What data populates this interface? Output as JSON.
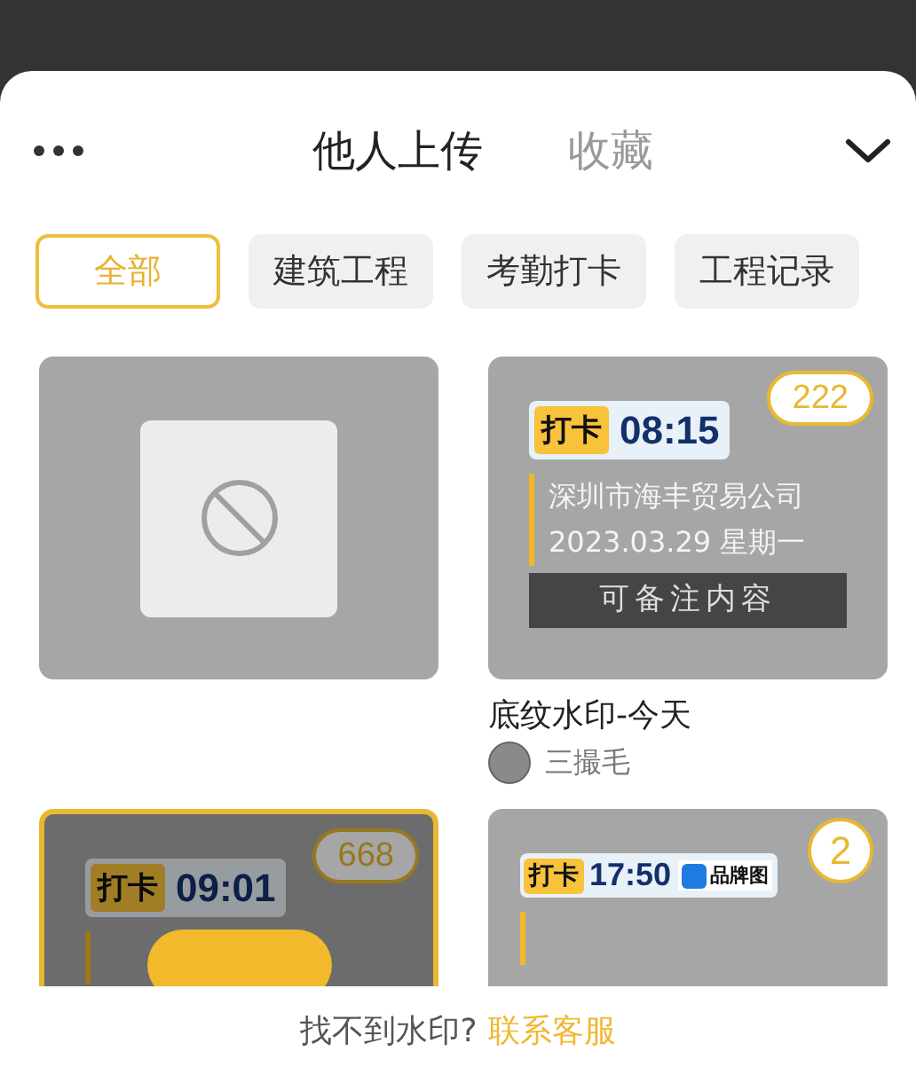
{
  "tabs": [
    {
      "label": "他人上传",
      "selected": true
    },
    {
      "label": "收藏",
      "selected": false
    }
  ],
  "chips": [
    {
      "label": "全部",
      "selected": true
    },
    {
      "label": "建筑工程",
      "selected": false
    },
    {
      "label": "考勤打卡",
      "selected": false
    },
    {
      "label": "工程记录",
      "selected": false
    }
  ],
  "cards": [
    {
      "kind": "empty",
      "selected": false
    },
    {
      "kind": "watermark",
      "selected": false,
      "count": "222",
      "stamp": "打卡",
      "time": "08:15",
      "company": "深圳市海丰贸易公司",
      "date": "2023.03.29 星期一",
      "note": "可备注内容",
      "title": "底纹水印-今天",
      "author": "三撮毛"
    },
    {
      "kind": "watermark",
      "selected": true,
      "count": "668",
      "stamp": "打卡",
      "time": "09:01"
    },
    {
      "kind": "watermark",
      "selected": false,
      "count": "2",
      "stamp": "打卡",
      "time": "17:50",
      "brand": "品牌图"
    }
  ],
  "footer": {
    "text": "找不到水印?",
    "link": "联系客服"
  }
}
